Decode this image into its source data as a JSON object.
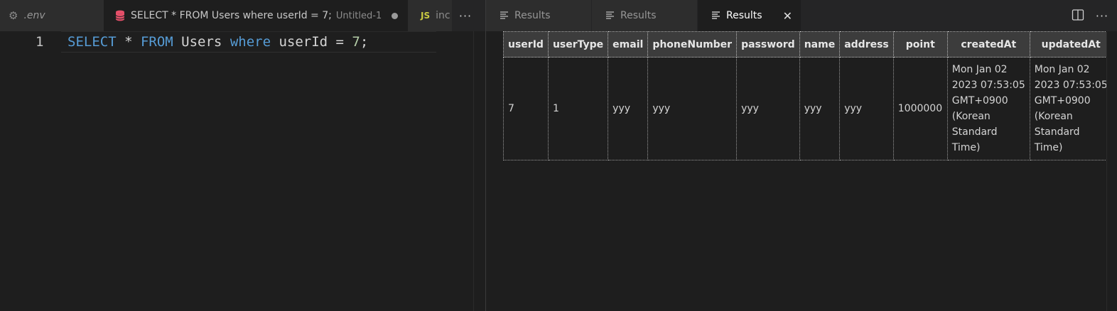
{
  "editor_tabs": [
    {
      "label": ".env",
      "icon": "gear-icon"
    },
    {
      "label": "SELECT * FROM Users where userId = 7;",
      "description": "Untitled-1",
      "icon": "database-icon",
      "dirty": true
    },
    {
      "label": "inc",
      "badge": "JS"
    }
  ],
  "editor": {
    "line_number": "1",
    "tokens": {
      "kw1": "SELECT",
      "t1": " * ",
      "kw2": "FROM",
      "t2": " Users ",
      "kw3": "where",
      "t3": " userId = ",
      "num": "7",
      "t4": ";"
    }
  },
  "result_tabs": [
    {
      "label": "Results"
    },
    {
      "label": "Results"
    },
    {
      "label": "Results",
      "active": true
    }
  ],
  "more_glyph": "···",
  "close_glyph": "✕",
  "table": {
    "columns": [
      "userId",
      "userType",
      "email",
      "phoneNumber",
      "password",
      "name",
      "address",
      "point",
      "createdAt",
      "updatedAt"
    ],
    "rows": [
      {
        "userId": "7",
        "userType": "1",
        "email": "yyy",
        "phoneNumber": "yyy",
        "password": "yyy",
        "name": "yyy",
        "address": "yyy",
        "point": "1000000",
        "createdAt": [
          "Mon Jan 02",
          "2023 07:53:05",
          "GMT+0900",
          "(Korean",
          "Standard",
          "Time)"
        ],
        "updatedAt": [
          "Mon Jan 02",
          "2023 07:53:05",
          "GMT+0900",
          "(Korean",
          "Standard",
          "Time)"
        ]
      }
    ]
  },
  "colors": {
    "keyword": "#569cd6",
    "number": "#b5cea8",
    "editor_bg": "#1e1e1e",
    "header_bg": "#3c3c3c"
  }
}
